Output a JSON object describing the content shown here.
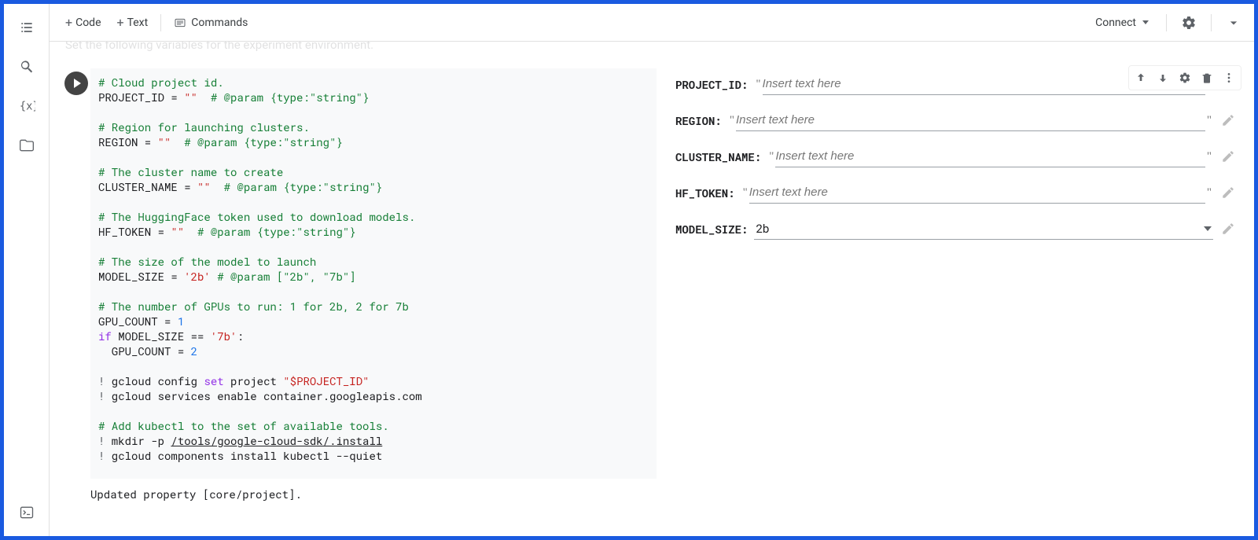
{
  "toolbar": {
    "code_label": "Code",
    "text_label": "Text",
    "commands_label": "Commands",
    "connect_label": "Connect"
  },
  "truncated_text_line": "Set the following variables for the experiment environment.",
  "code_lines": [
    [
      {
        "c": "c-comment",
        "t": "# Cloud project id."
      }
    ],
    [
      {
        "t": "PROJECT_ID = "
      },
      {
        "c": "c-str",
        "t": "\"\""
      },
      {
        "t": "  "
      },
      {
        "c": "c-comment",
        "t": "# @param {type:\"string\"}"
      }
    ],
    [
      {
        "t": ""
      }
    ],
    [
      {
        "c": "c-comment",
        "t": "# Region for launching clusters."
      }
    ],
    [
      {
        "t": "REGION = "
      },
      {
        "c": "c-str",
        "t": "\"\""
      },
      {
        "t": "  "
      },
      {
        "c": "c-comment",
        "t": "# @param {type:\"string\"}"
      }
    ],
    [
      {
        "t": ""
      }
    ],
    [
      {
        "c": "c-comment",
        "t": "# The cluster name to create"
      }
    ],
    [
      {
        "t": "CLUSTER_NAME = "
      },
      {
        "c": "c-str",
        "t": "\"\""
      },
      {
        "t": "  "
      },
      {
        "c": "c-comment",
        "t": "# @param {type:\"string\"}"
      }
    ],
    [
      {
        "t": ""
      }
    ],
    [
      {
        "c": "c-comment",
        "t": "# The HuggingFace token used to download models."
      }
    ],
    [
      {
        "t": "HF_TOKEN = "
      },
      {
        "c": "c-str",
        "t": "\"\""
      },
      {
        "t": "  "
      },
      {
        "c": "c-comment",
        "t": "# @param {type:\"string\"}"
      }
    ],
    [
      {
        "t": ""
      }
    ],
    [
      {
        "c": "c-comment",
        "t": "# The size of the model to launch"
      }
    ],
    [
      {
        "t": "MODEL_SIZE = "
      },
      {
        "c": "c-str",
        "t": "'2b'"
      },
      {
        "t": " "
      },
      {
        "c": "c-comment",
        "t": "# @param [\"2b\", \"7b\"]"
      }
    ],
    [
      {
        "t": ""
      }
    ],
    [
      {
        "c": "c-comment",
        "t": "# The number of GPUs to run: 1 for 2b, 2 for 7b"
      }
    ],
    [
      {
        "t": "GPU_COUNT = "
      },
      {
        "c": "c-num",
        "t": "1"
      }
    ],
    [
      {
        "c": "c-kw",
        "t": "if"
      },
      {
        "t": " MODEL_SIZE == "
      },
      {
        "c": "c-str",
        "t": "'7b'"
      },
      {
        "t": ":"
      }
    ],
    [
      {
        "t": "  GPU_COUNT = "
      },
      {
        "c": "c-num",
        "t": "2"
      }
    ],
    [
      {
        "t": ""
      }
    ],
    [
      {
        "c": "c-op",
        "t": "!"
      },
      {
        "t": " gcloud config "
      },
      {
        "c": "c-kw",
        "t": "set"
      },
      {
        "t": " project "
      },
      {
        "c": "c-str",
        "t": "\"$PROJECT_ID\""
      }
    ],
    [
      {
        "c": "c-op",
        "t": "!"
      },
      {
        "t": " gcloud services enable container.googleapis.com"
      }
    ],
    [
      {
        "t": ""
      }
    ],
    [
      {
        "c": "c-comment",
        "t": "# Add kubectl to the set of available tools."
      }
    ],
    [
      {
        "c": "c-op",
        "t": "!"
      },
      {
        "t": " mkdir -p "
      },
      {
        "c": "underline",
        "t": "/tools/google-cloud-sdk/.install"
      }
    ],
    [
      {
        "c": "c-op",
        "t": "!"
      },
      {
        "t": " gcloud components install kubectl --quiet"
      }
    ]
  ],
  "form": {
    "items": [
      {
        "label": "PROJECT_ID:",
        "placeholder": "Insert text here",
        "type": "text"
      },
      {
        "label": "REGION:",
        "placeholder": "Insert text here",
        "type": "text"
      },
      {
        "label": "CLUSTER_NAME:",
        "placeholder": "Insert text here",
        "type": "text"
      },
      {
        "label": "HF_TOKEN:",
        "placeholder": "Insert text here",
        "type": "text"
      },
      {
        "label": "MODEL_SIZE:",
        "value": "2b",
        "type": "select"
      }
    ]
  },
  "output_line": "Updated property [core/project]."
}
